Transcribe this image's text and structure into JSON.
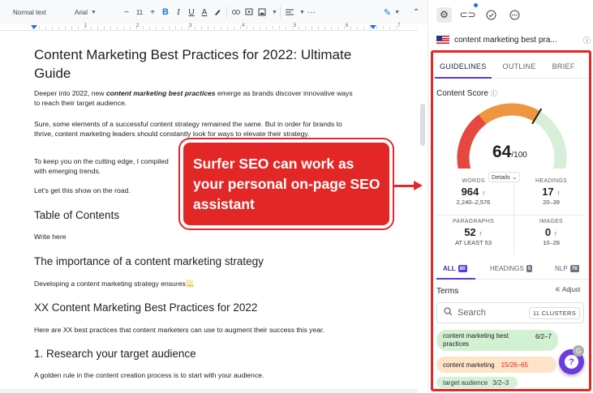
{
  "toolbar": {
    "style_label": "Normal text",
    "font_label": "Arial",
    "font_size": "11",
    "minus": "−",
    "plus": "+",
    "bold": "B",
    "italic": "I",
    "underline": "U",
    "text_color": "A",
    "more": "···"
  },
  "ruler": {
    "numbers": [
      "1",
      "2",
      "3",
      "4",
      "5",
      "6",
      "7"
    ]
  },
  "document": {
    "title": "Content Marketing Best Practices for 2022: Ultimate Guide",
    "intro_prefix": "Deeper into 2022, new ",
    "intro_keyword": "content marketing best practices",
    "intro_suffix": " emerge as brands discover innovative ways to reach their target audience.",
    "p2": "Sure, some elements of a successful content strategy remained the same. But in order for brands to thrive, content marketing leaders should constantly look for ways to elevate their strategy.",
    "p3": "To keep you on the cutting edge, I compiled",
    "p3_line2": "with emerging trends.",
    "p4": "Let's get this show on the road.",
    "h_toc": "Table of Contents",
    "toc_placeholder": "Write here",
    "h_importance": "The importance of a content marketing strategy",
    "p5": "Developing a content marketing strategy ensures",
    "p5_hl": " ...",
    "h_xx": "XX Content Marketing Best Practices for 2022",
    "p6": "Here are XX best practices that content marketers can use to augment their success this year.",
    "h_research": "1. Research your target audience",
    "p7": "A golden rule in the content creation process is to start with your audience."
  },
  "callout": {
    "text": "Surfer SEO can work as your personal on-page SEO assistant",
    "color": "#e22726"
  },
  "extension": {
    "icons": [
      "gear-icon",
      "link-icon",
      "check-circle-icon",
      "more-circle-icon"
    ],
    "doc_name": "content marketing best pra...",
    "info": "ⓘ"
  },
  "panel": {
    "tabs": [
      "GUIDELINES",
      "OUTLINE",
      "BRIEF"
    ],
    "score_label": "Content Score",
    "score_value": 64,
    "score_value_text": "64",
    "score_max": "/100",
    "details_label": "Details",
    "stats": {
      "words": {
        "label": "WORDS",
        "value": "964",
        "range": "2,240–2,576"
      },
      "headings": {
        "label": "HEADINGS",
        "value": "17",
        "range": "20–39"
      },
      "paragraphs": {
        "label": "PARAGRAPHS",
        "value": "52",
        "range": "AT LEAST 53"
      },
      "images": {
        "label": "IMAGES",
        "value": "0",
        "range": "10–28"
      }
    },
    "up_arrow": "↑",
    "filter_tabs": {
      "all": "ALL",
      "all_count": "80",
      "headings": "HEADINGS",
      "headings_count": "5",
      "nlp": "NLP",
      "nlp_count": "76"
    },
    "terms_title": "Terms",
    "adjust_label": "Adjust",
    "search_placeholder": "Search",
    "clusters_label": "11 CLUSTERS",
    "terms": [
      {
        "text": "content marketing best practices",
        "count": "6/2–7"
      },
      {
        "text": "content marketing",
        "count": "15/26–65"
      },
      {
        "text": "target audience",
        "count": "3/2–3"
      }
    ],
    "help_label": "?",
    "colors": {
      "accent": "#5b39d8",
      "gauge_red": "#e5483f",
      "gauge_orange": "#f0953f",
      "gauge_green": "#d7eed9"
    }
  }
}
